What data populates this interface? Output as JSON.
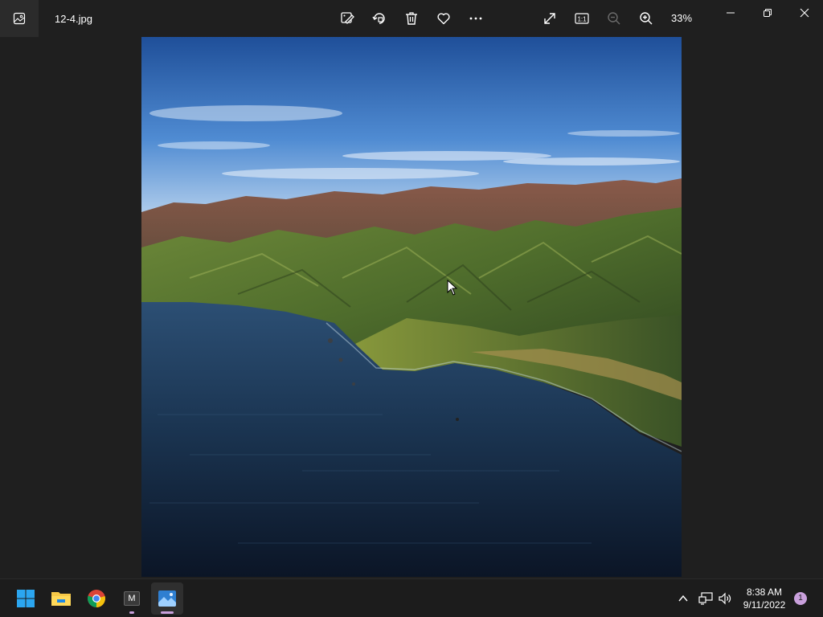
{
  "window": {
    "filename": "12-4.jpg",
    "zoom_level": "33%",
    "toolbar_icons": [
      "edit-image-icon",
      "rotate-icon",
      "delete-icon",
      "favorite-icon",
      "more-icon"
    ],
    "view_icons": [
      "fullscreen-icon",
      "actual-size-icon",
      "zoom-out-icon",
      "zoom-in-icon"
    ],
    "actual_size_label": "1:1"
  },
  "taskbar": {
    "apps": [
      {
        "name": "start-button",
        "icon": "windows-logo-icon"
      },
      {
        "name": "file-explorer",
        "icon": "folder-icon"
      },
      {
        "name": "chrome",
        "icon": "chrome-icon"
      },
      {
        "name": "app-m",
        "icon": "m-app-icon",
        "label": "M"
      },
      {
        "name": "photos",
        "icon": "photos-icon"
      }
    ],
    "clock": {
      "time": "8:38 AM",
      "date": "9/11/2022"
    },
    "notification_count": "1"
  },
  "colors": {
    "background": "#1f1f1f",
    "taskbar": "#1c1c1c",
    "accent": "#c9a0dc"
  }
}
